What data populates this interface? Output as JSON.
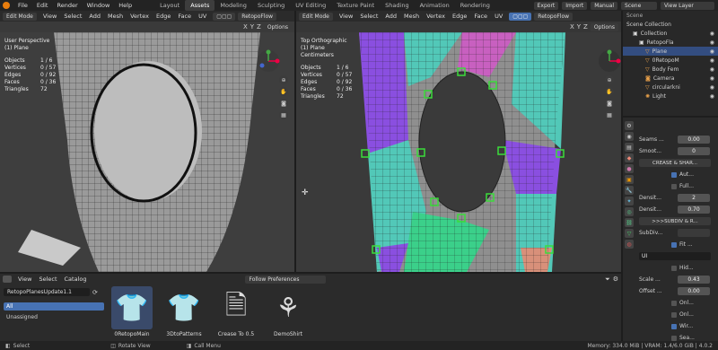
{
  "topbar": {
    "menus": [
      "File",
      "Edit",
      "Render",
      "Window",
      "Help"
    ],
    "workspaces": [
      "Layout",
      "Assets",
      "Modeling",
      "Sculpting",
      "UV Editing",
      "Texture Paint",
      "Shading",
      "Animation",
      "Rendering"
    ],
    "active_workspace": "Assets",
    "export_label": "Export",
    "import_label": "Import",
    "manual_label": "Manual",
    "scene_label": "Scene",
    "view_layer_label": "View Layer"
  },
  "viewport_left": {
    "mode": "Edit Mode",
    "menus": [
      "View",
      "Select",
      "Add",
      "Mesh",
      "Vertex",
      "Edge",
      "Face",
      "UV"
    ],
    "addon": "RetopoFlow",
    "xyz": [
      "X",
      "Y",
      "Z"
    ],
    "options": "Options",
    "title": "User Perspective",
    "object": "(1) Plane",
    "stats": [
      {
        "label": "Objects",
        "value": "1 / 6"
      },
      {
        "label": "Vertices",
        "value": "0 / 57"
      },
      {
        "label": "Edges",
        "value": "0 / 92"
      },
      {
        "label": "Faces",
        "value": "0 / 36"
      },
      {
        "label": "Triangles",
        "value": "72"
      }
    ]
  },
  "viewport_right": {
    "mode": "Edit Mode",
    "menus": [
      "View",
      "Select",
      "Add",
      "Mesh",
      "Vertex",
      "Edge",
      "Face",
      "UV"
    ],
    "addon": "RetopoFlow",
    "xyz": [
      "X",
      "Y",
      "Z"
    ],
    "options": "Options",
    "title": "Top Orthographic",
    "object": "(1) Plane",
    "units": "Centimeters",
    "stats": [
      {
        "label": "Objects",
        "value": "1 / 6"
      },
      {
        "label": "Vertices",
        "value": "0 / 57"
      },
      {
        "label": "Edges",
        "value": "0 / 92"
      },
      {
        "label": "Faces",
        "value": "0 / 36"
      },
      {
        "label": "Triangles",
        "value": "72"
      }
    ]
  },
  "outliner": {
    "title": "Scene Collection",
    "items": [
      {
        "name": "Collection",
        "level": 1
      },
      {
        "name": "RetopoFla",
        "level": 2
      },
      {
        "name": "Plane",
        "level": 3,
        "selected": true
      },
      {
        "name": "0RetopoM",
        "level": 3
      },
      {
        "name": "Body Fem",
        "level": 3
      },
      {
        "name": "Camera",
        "level": 3
      },
      {
        "name": "circularkni",
        "level": 3
      },
      {
        "name": "Light",
        "level": 3
      }
    ]
  },
  "properties": {
    "rows": [
      {
        "label": "Seams ...",
        "value": "0.00"
      },
      {
        "label": "Smoot...",
        "value": "0"
      }
    ],
    "crease_btn": "CREASE & SHAR...",
    "checks": [
      {
        "label": "Aut...",
        "on": true
      },
      {
        "label": "Full...",
        "on": false
      }
    ],
    "rows2": [
      {
        "label": "Densit...",
        "value": "2"
      },
      {
        "label": "Densit...",
        "value": "0.70"
      }
    ],
    "subdiv_btn": ">>>SUBDIV & R...",
    "subdiv_label": "SubDiv...",
    "fit_label": "Fit ...",
    "uv_value": "UI",
    "hid_label": "Hid...",
    "scale_label": "Scale ...",
    "scale_value": "0.43",
    "offset_label": "Offset ...",
    "offset_value": "0.00",
    "onl1": "Onl...",
    "onl2": "Onl...",
    "wir": "Wir...",
    "sea": "Sea..."
  },
  "asset_browser": {
    "menus": [
      "View",
      "Select",
      "Catalog"
    ],
    "library": "RetopoPlanesUpdate1.1",
    "import_method": "Follow Preferences",
    "catalogs": [
      "All",
      "Unassigned"
    ],
    "assets": [
      {
        "name": "0RetopoMain",
        "icon": "shirt-retopo-icon",
        "selected": true
      },
      {
        "name": "3DtoPatterns",
        "icon": "shirt-pattern-icon"
      },
      {
        "name": "Crease To 0.5",
        "icon": "document-icon"
      },
      {
        "name": "DemoShirt",
        "icon": "shirt-pieces-icon"
      }
    ]
  },
  "statusbar": {
    "select": "Select",
    "rotate": "Rotate View",
    "menu": "Call Menu",
    "memory": "Memory: 334.0 MiB | VRAM: 1.4/6.0 GiB | 4.0.2"
  },
  "colors": {
    "accent": "#4772b3",
    "vertex_green": "#3bdc3b",
    "purple": "#8a4fe0",
    "teal": "#52c8b8",
    "pink": "#c860c0"
  }
}
